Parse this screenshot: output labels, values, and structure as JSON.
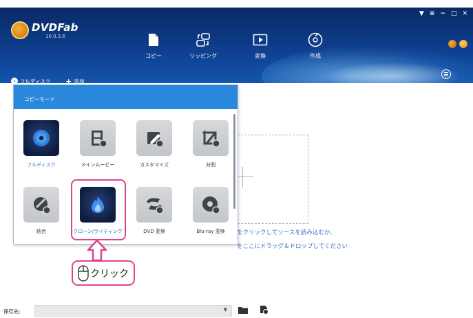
{
  "app": {
    "name": "DVDFab",
    "version": "10.0.3.6"
  },
  "nav_tabs": [
    {
      "label": "コピー",
      "icon": "copy-icon"
    },
    {
      "label": "リッピング",
      "icon": "ripper-icon"
    },
    {
      "label": "変換",
      "icon": "converter-icon"
    },
    {
      "label": "作成",
      "icon": "creator-icon"
    }
  ],
  "window_controls": {
    "icons": [
      "dropdown-icon",
      "download-icon",
      "minimize-icon",
      "restore-icon",
      "close-icon"
    ],
    "symbols": [
      "▼",
      "≡",
      "−",
      "□",
      "✕"
    ]
  },
  "toolbar": {
    "full_disc_label": "フルディスク",
    "add_label": "追加"
  },
  "copy_mode_panel": {
    "header": "コピーモード",
    "modes": [
      {
        "label": "フルディスク",
        "icon": "full-disc-icon",
        "style": "dark"
      },
      {
        "label": "メインムービー",
        "icon": "main-movie-icon",
        "style": "gray"
      },
      {
        "label": "カスタマイズ",
        "icon": "customize-icon",
        "style": "gray"
      },
      {
        "label": "分割",
        "icon": "split-icon",
        "style": "gray"
      },
      {
        "label": "結合",
        "icon": "merge-icon",
        "style": "gray"
      },
      {
        "label": "クローン/ライティング",
        "icon": "clone-burn-icon",
        "style": "dark"
      },
      {
        "label": "DVD 変換",
        "icon": "dvd-convert-icon",
        "style": "gray"
      },
      {
        "label": "Blu-ray 変換",
        "icon": "bluray-convert-icon",
        "style": "gray"
      }
    ]
  },
  "drop_hint": {
    "line1": "をクリックしてソースを読み込むか、",
    "line2": "をここにドラッグ＆ドロップしてください"
  },
  "callout": {
    "text": "クリック",
    "icon": "mouse-icon"
  },
  "save_to": {
    "label": "保存先:",
    "value": ""
  },
  "colors": {
    "header_dark": "#0a2a66",
    "header_light": "#1454ad",
    "panel_header": "#2a88dc",
    "highlight": "#e0428c",
    "hint_text": "#3b6fc5"
  }
}
